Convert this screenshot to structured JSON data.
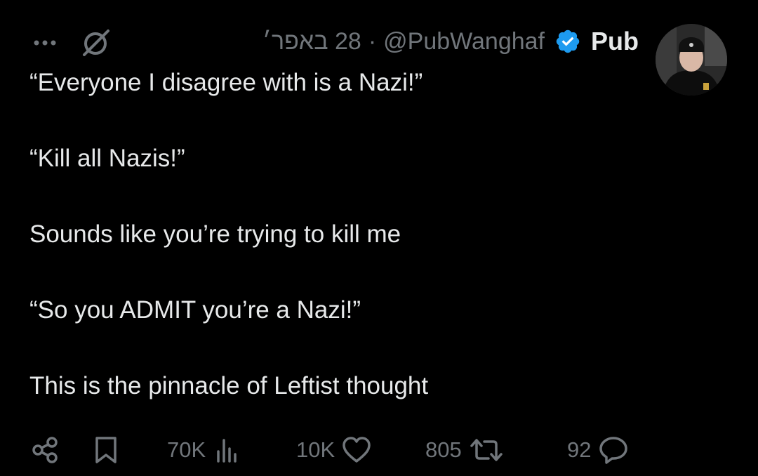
{
  "post": {
    "display_name": "Pub",
    "handle": "@PubWanghaf",
    "separator": "·",
    "date": "28 באפר׳",
    "verified_color": "#1d9bf0",
    "paragraphs": [
      "“Everyone I disagree with is a Nazi!”",
      "“Kill all Nazis!”",
      "Sounds like you’re trying to kill me",
      "“So you ADMIT you’re a Nazi!”",
      "This is the pinnacle of Leftist thought"
    ],
    "icons": {
      "more": "more-icon",
      "grok": "grok-icon",
      "verified": "verified-badge-icon",
      "share": "share-icon",
      "bookmark": "bookmark-icon",
      "views": "views-icon",
      "like": "heart-icon",
      "repost": "repost-icon",
      "reply": "reply-icon"
    }
  },
  "actions": {
    "views": "70K",
    "likes": "10K",
    "reposts": "805",
    "replies": "92"
  }
}
